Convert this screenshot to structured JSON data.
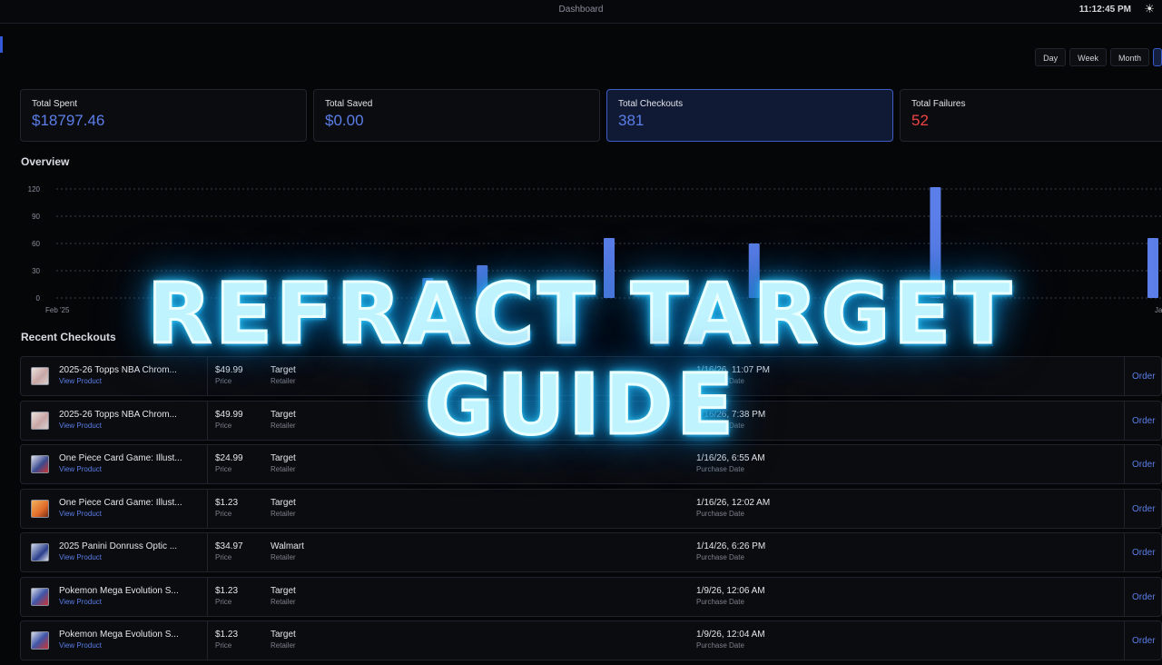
{
  "topbar": {
    "title": "Dashboard",
    "clock": "11:12:45 PM",
    "theme_icon": "sun-icon"
  },
  "range": {
    "options": [
      "Day",
      "Week",
      "Month"
    ]
  },
  "stats": [
    {
      "label": "Total Spent",
      "value": "$18797.46",
      "color": "#5b7ee8"
    },
    {
      "label": "Total Saved",
      "value": "$0.00",
      "color": "#5b7ee8"
    },
    {
      "label": "Total Checkouts",
      "value": "381",
      "color": "#5b7ee8"
    },
    {
      "label": "Total Failures",
      "value": "52",
      "color": "#ef4444"
    }
  ],
  "overview": {
    "title": "Overview",
    "chart_data": {
      "type": "bar",
      "ylim": [
        0,
        120
      ],
      "yticks": [
        "0",
        "30",
        "60",
        "90",
        "120"
      ],
      "xlabels": [
        "Feb '25",
        "Ja"
      ],
      "values": [
        0,
        0,
        0,
        0,
        0,
        0,
        0,
        0,
        0,
        0,
        0,
        0,
        0,
        0,
        0,
        0,
        0,
        0,
        0,
        0,
        22,
        0,
        0,
        36,
        0,
        0,
        0,
        0,
        0,
        0,
        66,
        0,
        0,
        0,
        0,
        0,
        0,
        0,
        60,
        0,
        0,
        0,
        0,
        0,
        0,
        0,
        0,
        0,
        122,
        0,
        0,
        0,
        0,
        0,
        0,
        0,
        0,
        0,
        0,
        0,
        66
      ],
      "bar_color": "#5b7ee8",
      "grid": true
    }
  },
  "recent": {
    "title": "Recent Checkouts",
    "view_label": "View Product",
    "price_label": "Price",
    "retailer_label": "Retailer",
    "date_label": "Purchase Date",
    "order_label": "Order",
    "rows": [
      {
        "name": "2025-26 Topps NBA Chrom...",
        "price": "$49.99",
        "retailer": "Target",
        "date": "1/16/26, 11:07 PM",
        "thumb": "t0"
      },
      {
        "name": "2025-26 Topps NBA Chrom...",
        "price": "$49.99",
        "retailer": "Target",
        "date": "1/16/26, 7:38 PM",
        "thumb": "t0"
      },
      {
        "name": "One Piece Card Game: Illust...",
        "price": "$24.99",
        "retailer": "Target",
        "date": "1/16/26, 6:55 AM",
        "thumb": "t1"
      },
      {
        "name": "One Piece Card Game: Illust...",
        "price": "$1.23",
        "retailer": "Target",
        "date": "1/16/26, 12:02 AM",
        "thumb": "t2"
      },
      {
        "name": "2025 Panini Donruss Optic ...",
        "price": "$34.97",
        "retailer": "Walmart",
        "date": "1/14/26, 6:26 PM",
        "thumb": "t3"
      },
      {
        "name": "Pokemon Mega Evolution S...",
        "price": "$1.23",
        "retailer": "Target",
        "date": "1/9/26, 12:06 AM",
        "thumb": "t4"
      },
      {
        "name": "Pokemon Mega Evolution S...",
        "price": "$1.23",
        "retailer": "Target",
        "date": "1/9/26, 12:04 AM",
        "thumb": "t4"
      }
    ]
  },
  "overlay": {
    "title": "REFRACT TARGET GUIDE"
  }
}
